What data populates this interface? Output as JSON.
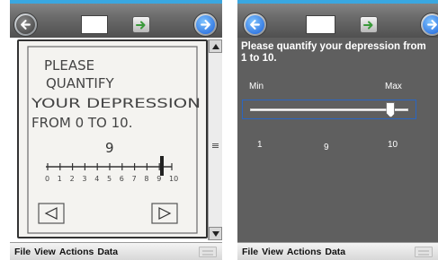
{
  "left_screen": {
    "sketch_text": [
      "PLEASE",
      "QUANTIFY",
      "YOUR DEPRESSION",
      "FROM 0 TO 10."
    ],
    "sketch_value": "9",
    "sketch_ticks": [
      "0",
      "1",
      "2",
      "3",
      "4",
      "5",
      "6",
      "7",
      "8",
      "9",
      "10"
    ],
    "menu": [
      "File",
      "View",
      "Actions",
      "Data"
    ]
  },
  "right_screen": {
    "question": "Please quantify your depression from 1 to 10.",
    "min_label": "Min",
    "max_label": "Max",
    "min_value": "1",
    "max_value": "10",
    "current_value": "9",
    "slider_min": 1,
    "slider_max": 10,
    "slider_value": 9,
    "menu": [
      "File",
      "View",
      "Actions",
      "Data"
    ]
  },
  "colors": {
    "accent": "#2a66c2",
    "right_background": "#5f5f5f",
    "top_strip": "#3aa7e0"
  }
}
